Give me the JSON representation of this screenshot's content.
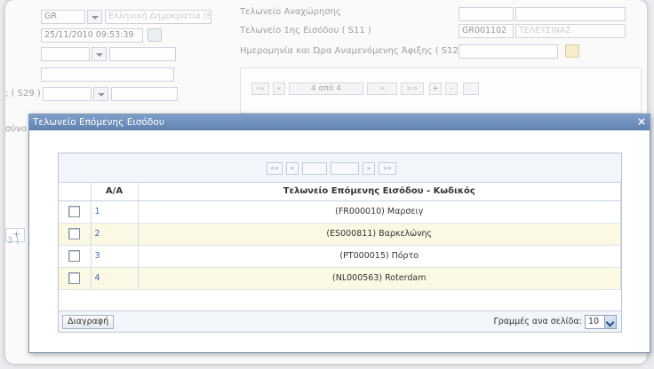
{
  "background": {
    "fields": {
      "country_code": "GR",
      "country_name": "Ελληνική Δημοκρατία (Ελλάδα)",
      "datetime": "25/11/2010 09:53:39",
      "office_first_entry_code": "GR001102",
      "office_first_entry_name": "ΤΕΛΕΥΣΙΝΑΣ"
    },
    "labels": {
      "top_partial": "Τελωνείο Αναχώρησης",
      "first_entry_office": "Τελωνείο 1ης Εισόδου ( S11 )",
      "expected_arrival": "Ημερομηνία και Ώρα Αναμενόμενης Άφιξης ( S12 )",
      "s29": "; ( S29 )",
      "left_partial": "σύνο",
      "left_code_partial": "3 )"
    },
    "pager": {
      "first": "«« ",
      "prev": "«",
      "info": "4 από 4",
      "next": ">",
      "last": ">>",
      "add": "+",
      "remove": "-"
    }
  },
  "modal": {
    "title": "Τελωνείο Επόμενης Εισόδου",
    "close": "×",
    "pager": {
      "first": "««",
      "prev": "«",
      "next": "»",
      "last": "»»"
    },
    "columns": {
      "index": "A/A",
      "office": "Τελωνείο Επόμενης Εισόδου - Κωδικός"
    },
    "rows": [
      {
        "index": "1",
        "office": "(FR000010) Μαρσειγ"
      },
      {
        "index": "2",
        "office": "(ES000811) Βαρκελώνης"
      },
      {
        "index": "3",
        "office": "(PT000015) Πόρτο"
      },
      {
        "index": "4",
        "office": "(NL000563) Roterdam"
      }
    ],
    "delete_button": "Διαγραφή",
    "rows_per_page_label": "Γραμμές ανα σελίδα:",
    "rows_per_page_value": "10"
  }
}
